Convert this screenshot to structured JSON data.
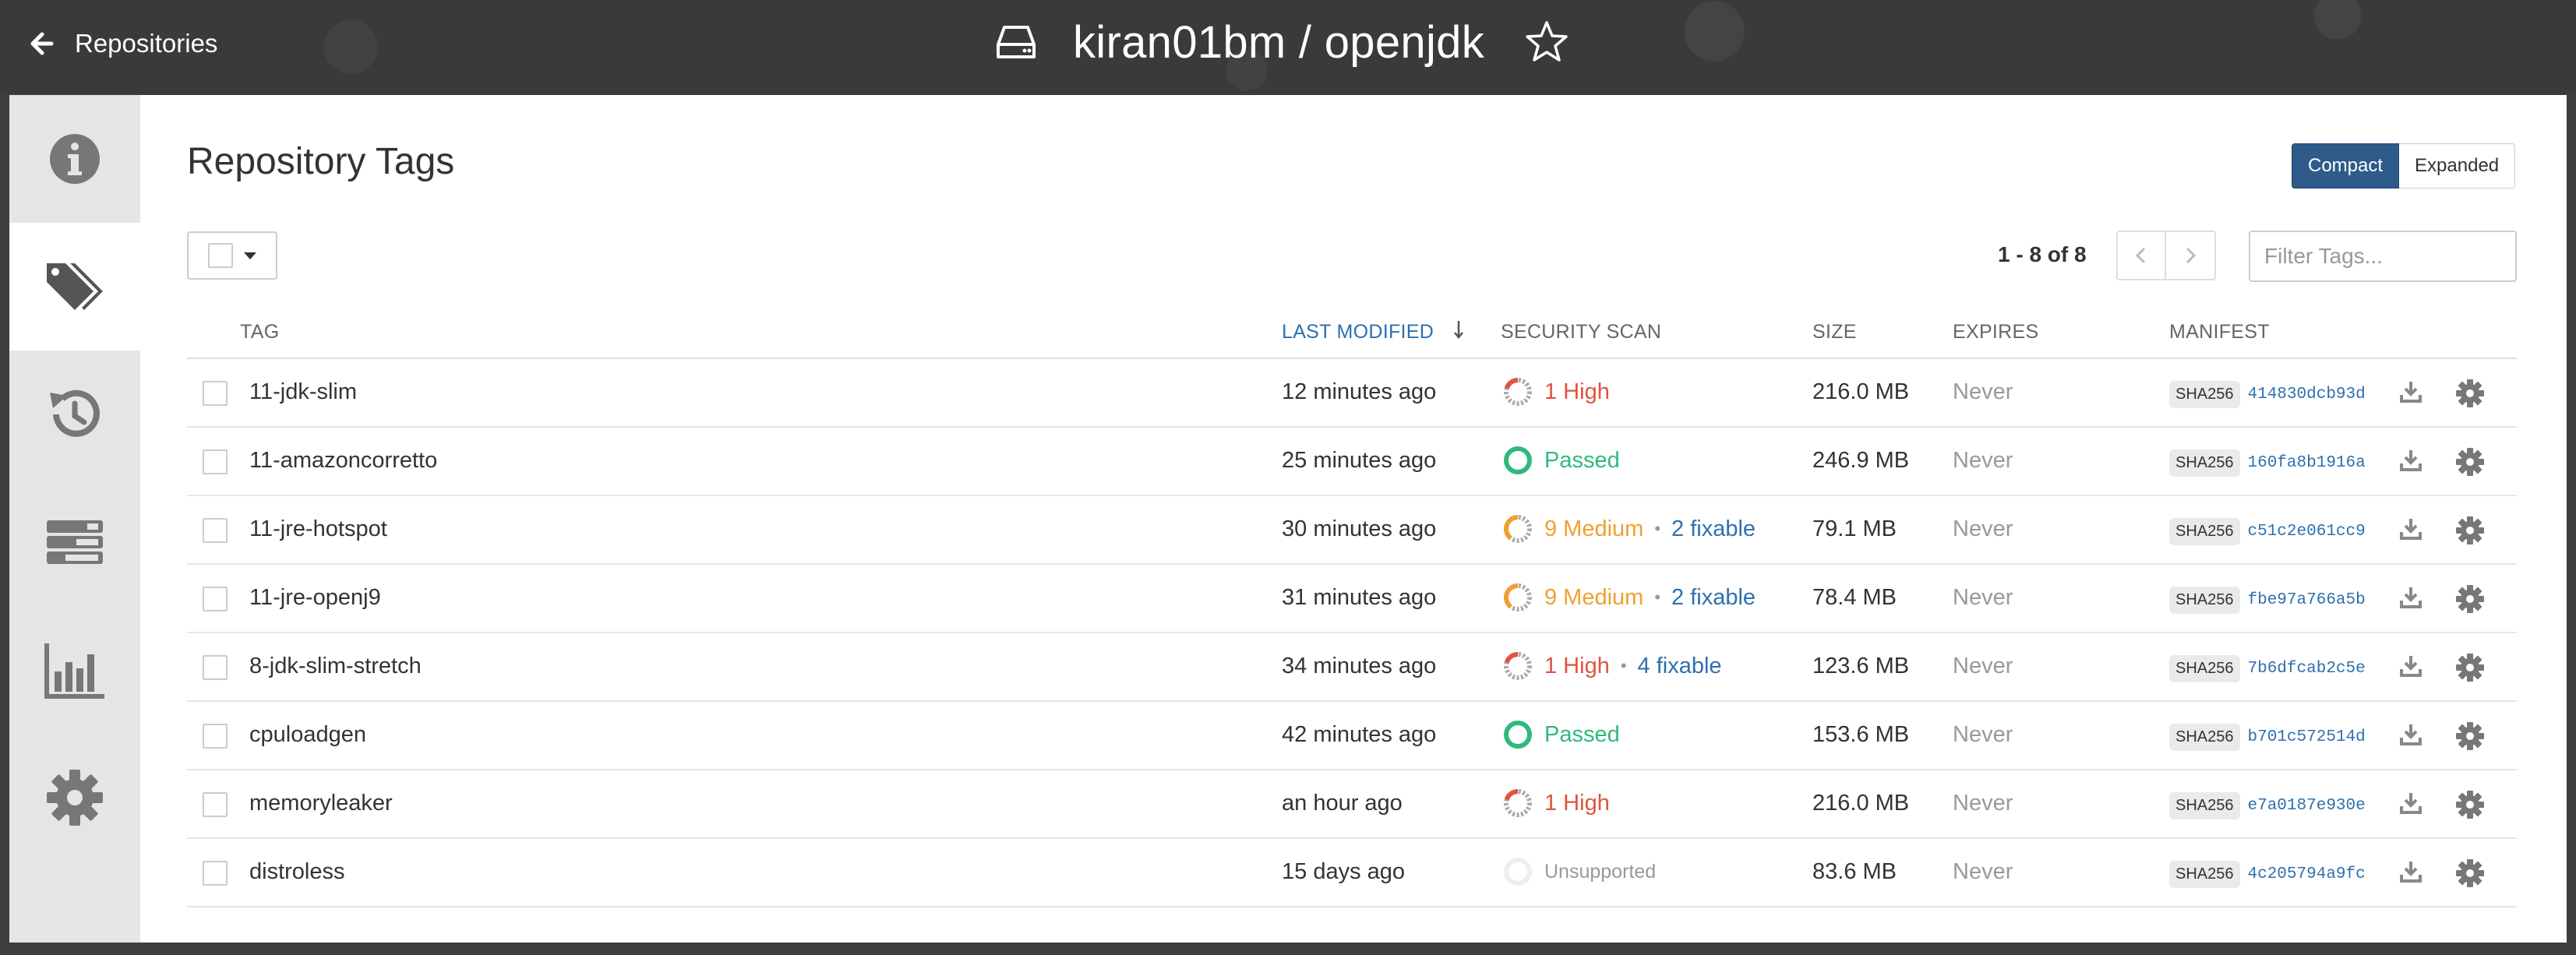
{
  "header": {
    "back_label": "Repositories",
    "title": "kiran01bm / openjdk"
  },
  "sidebar": {
    "items": [
      {
        "name": "info-icon",
        "active": false
      },
      {
        "name": "tags-icon",
        "active": true
      },
      {
        "name": "history-icon",
        "active": false
      },
      {
        "name": "builds-icon",
        "active": false
      },
      {
        "name": "usage-chart-icon",
        "active": false
      },
      {
        "name": "settings-icon",
        "active": false
      }
    ]
  },
  "main": {
    "title": "Repository Tags",
    "view_toggle": {
      "compact": "Compact",
      "expanded": "Expanded",
      "selected": "Compact"
    },
    "pager": {
      "text": "1 - 8 of 8"
    },
    "filter": {
      "placeholder": "Filter Tags..."
    },
    "columns": {
      "tag": "TAG",
      "last_modified": "LAST MODIFIED",
      "security_scan": "SECURITY SCAN",
      "size": "SIZE",
      "expires": "EXPIRES",
      "manifest": "MANIFEST"
    },
    "sha_label": "SHA256",
    "rows": [
      {
        "tag": "11-jdk-slim",
        "modified": "12 minutes ago",
        "scan": {
          "status": "1 High",
          "level": "high",
          "fixable": ""
        },
        "size": "216.0 MB",
        "expires": "Never",
        "digest": "414830dcb93d"
      },
      {
        "tag": "11-amazoncorretto",
        "modified": "25 minutes ago",
        "scan": {
          "status": "Passed",
          "level": "passed",
          "fixable": ""
        },
        "size": "246.9 MB",
        "expires": "Never",
        "digest": "160fa8b1916a"
      },
      {
        "tag": "11-jre-hotspot",
        "modified": "30 minutes ago",
        "scan": {
          "status": "9 Medium",
          "level": "medium",
          "fixable": "2 fixable"
        },
        "size": "79.1 MB",
        "expires": "Never",
        "digest": "c51c2e061cc9"
      },
      {
        "tag": "11-jre-openj9",
        "modified": "31 minutes ago",
        "scan": {
          "status": "9 Medium",
          "level": "medium",
          "fixable": "2 fixable"
        },
        "size": "78.4 MB",
        "expires": "Never",
        "digest": "fbe97a766a5b"
      },
      {
        "tag": "8-jdk-slim-stretch",
        "modified": "34 minutes ago",
        "scan": {
          "status": "1 High",
          "level": "high",
          "fixable": "4 fixable"
        },
        "size": "123.6 MB",
        "expires": "Never",
        "digest": "7b6dfcab2c5e"
      },
      {
        "tag": "cpuloadgen",
        "modified": "42 minutes ago",
        "scan": {
          "status": "Passed",
          "level": "passed",
          "fixable": ""
        },
        "size": "153.6 MB",
        "expires": "Never",
        "digest": "b701c572514d"
      },
      {
        "tag": "memoryleaker",
        "modified": "an hour ago",
        "scan": {
          "status": "1 High",
          "level": "high",
          "fixable": ""
        },
        "size": "216.0 MB",
        "expires": "Never",
        "digest": "e7a0187e930e"
      },
      {
        "tag": "distroless",
        "modified": "15 days ago",
        "scan": {
          "status": "Unsupported",
          "level": "unsupported",
          "fixable": ""
        },
        "size": "83.6 MB",
        "expires": "Never",
        "digest": "4c205794a9fc"
      }
    ]
  },
  "colors": {
    "accent": "#2f5b8a",
    "link": "#2f6fae",
    "high": "#e0533f",
    "medium": "#f0a030",
    "passed": "#2fba7c"
  }
}
